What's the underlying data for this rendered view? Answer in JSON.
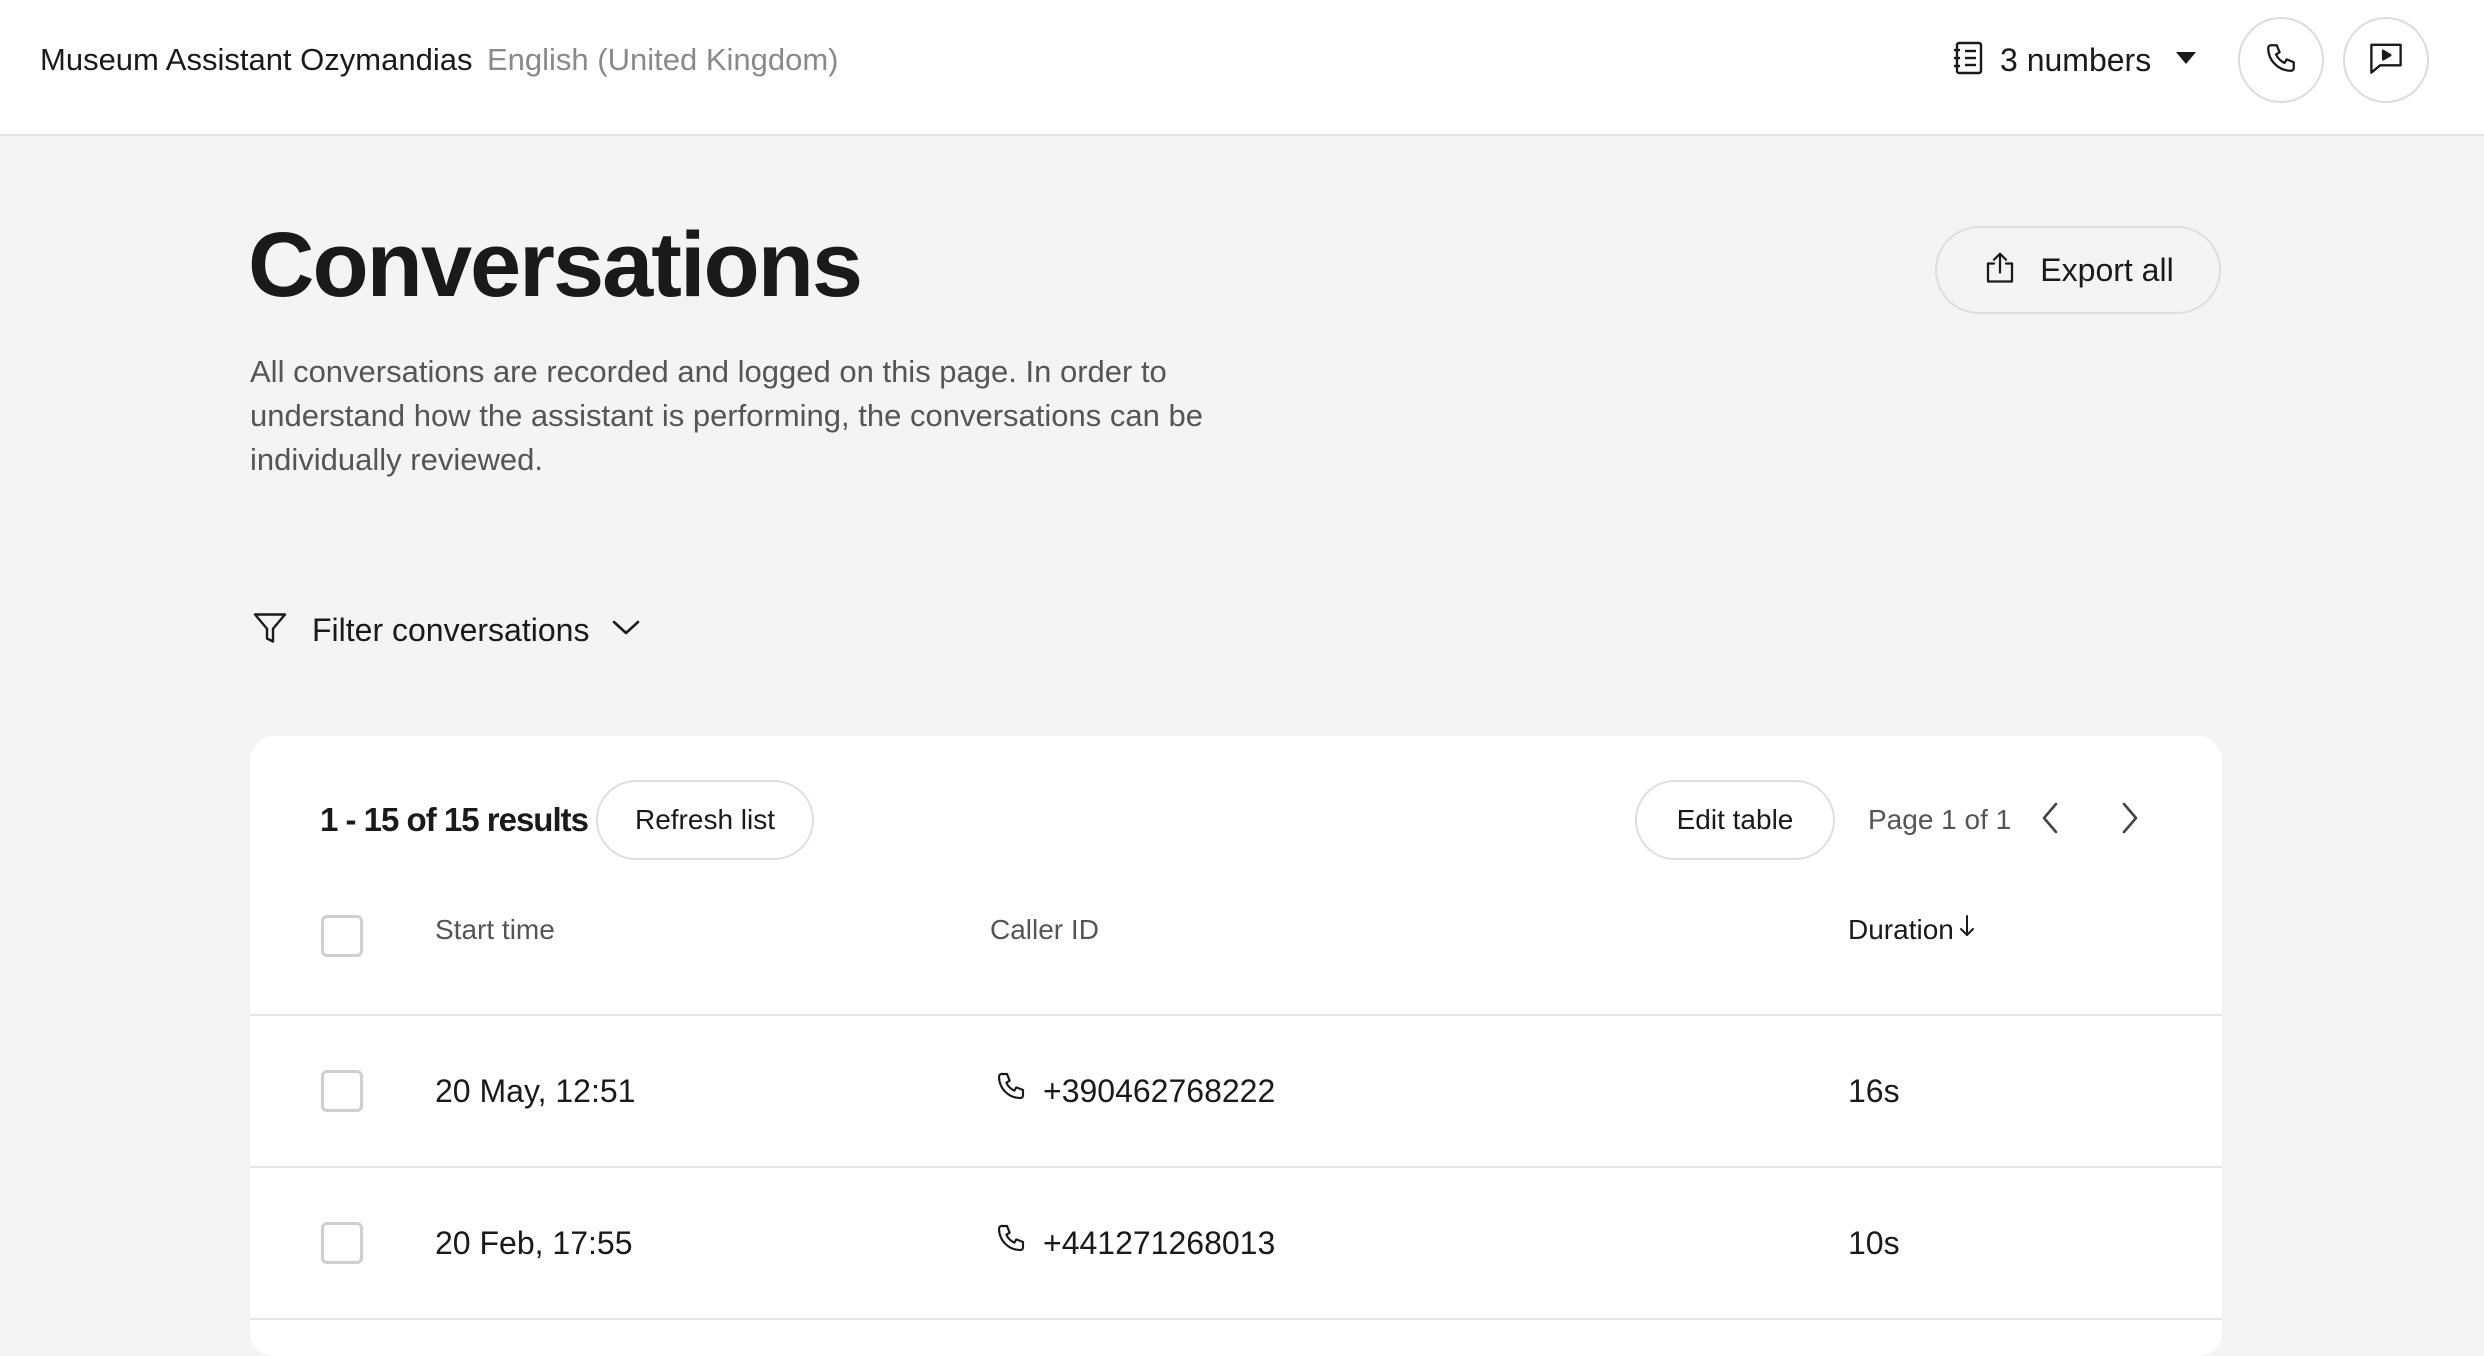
{
  "header": {
    "app_name": "Museum Assistant Ozymandias",
    "language": "English (United Kingdom)",
    "numbers_label": "3 numbers"
  },
  "page": {
    "title": "Conversations",
    "description": "All conversations are recorded and logged on this page. In order to understand how the assistant is performing, the conversations can be individually reviewed.",
    "export_label": "Export all",
    "filter_label": "Filter conversations"
  },
  "table": {
    "results_label": "1 - 15 of 15 results",
    "refresh_label": "Refresh list",
    "edit_label": "Edit table",
    "page_label": "Page 1 of 1",
    "columns": {
      "start_time": "Start time",
      "caller_id": "Caller ID",
      "duration": "Duration"
    },
    "rows": [
      {
        "start_time": "20 May, 12:51",
        "caller_id": "+390462768222",
        "duration": "16s"
      },
      {
        "start_time": "20 Feb, 17:55",
        "caller_id": "+441271268013",
        "duration": "10s"
      }
    ]
  },
  "colors": {
    "background": "#f4f4f4",
    "surface": "#ffffff",
    "text": "#1a1a1a",
    "muted": "#555555",
    "border": "#dedede"
  },
  "icons": {
    "numbers": "phonebook-icon",
    "dropdown": "caret-down-icon",
    "call": "phone-icon",
    "chat": "chat-play-icon",
    "export": "upload-icon",
    "filter": "filter-icon",
    "filter_toggle": "chevron-down-icon",
    "sort": "arrow-down-icon",
    "prev": "chevron-left-icon",
    "next": "chevron-right-icon",
    "caller": "phone-icon"
  }
}
